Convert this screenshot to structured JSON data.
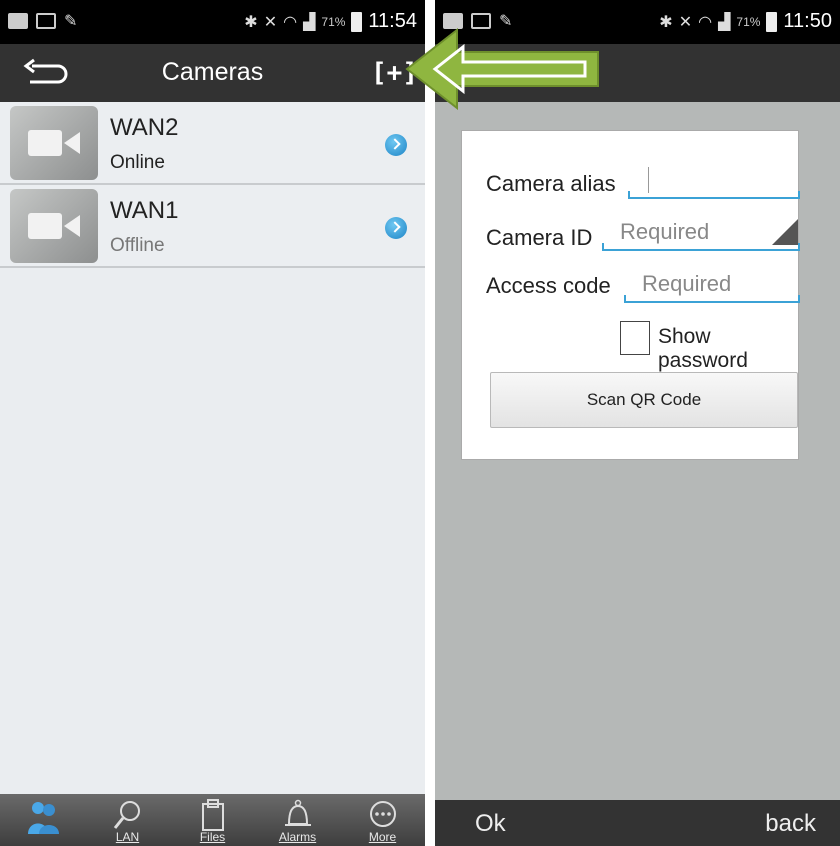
{
  "left_screen": {
    "status_bar": {
      "battery": "71%",
      "time": "11:54"
    },
    "action_bar": {
      "title": "Cameras",
      "add_label": "+"
    },
    "cameras": [
      {
        "name": "WAN2",
        "status": "Online"
      },
      {
        "name": "WAN1",
        "status": "Offline"
      }
    ],
    "tabs": [
      {
        "label": "",
        "icon": "users-icon",
        "active": true
      },
      {
        "label": "LAN",
        "icon": "search-icon",
        "active": false
      },
      {
        "label": "Files",
        "icon": "clipboard-icon",
        "active": false
      },
      {
        "label": "Alarms",
        "icon": "bell-icon",
        "active": false
      },
      {
        "label": "More",
        "icon": "more-icon",
        "active": false
      }
    ]
  },
  "right_screen": {
    "status_bar": {
      "battery": "71%",
      "time": "11:50"
    },
    "form": {
      "alias_label": "Camera alias",
      "alias_value": "",
      "id_label": "Camera ID",
      "id_placeholder": "Required",
      "code_label": "Access code",
      "code_placeholder": "Required",
      "show_password_label": "Show password",
      "scan_button": "Scan QR Code"
    },
    "buttons": {
      "ok": "Ok",
      "back": "back"
    }
  },
  "colors": {
    "accent_blue": "#3ba2d6",
    "arrow_green": "#8fb640",
    "action_bar": "#323232"
  }
}
